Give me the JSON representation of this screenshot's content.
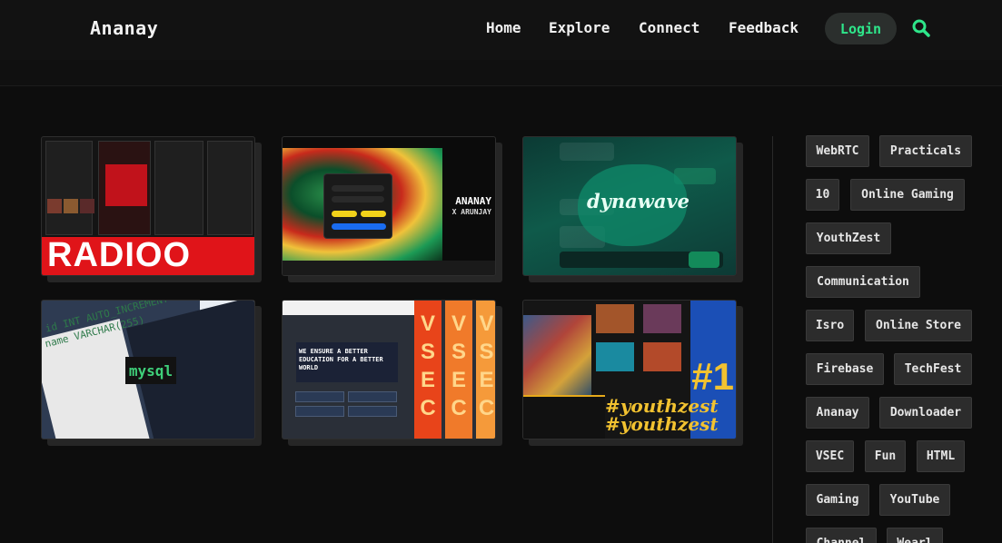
{
  "brand": "Ananay",
  "nav": {
    "links": [
      "Home",
      "Explore",
      "Connect",
      "Feedback"
    ],
    "login": "Login"
  },
  "cards": [
    {
      "title": "RADIOO"
    },
    {
      "title": "ANANAY",
      "subtitle": "X ARUNJAY"
    },
    {
      "title": "dynawave"
    },
    {
      "title": "mysql"
    },
    {
      "title": "VSEC",
      "banner": "WE ENSURE A BETTER EDUCATION FOR A BETTER WORLD"
    },
    {
      "title": "#youthzest",
      "badge": "#1"
    }
  ],
  "tags": [
    "WebRTC",
    "Practicals",
    "10",
    "Online Gaming",
    "YouthZest",
    "Communication",
    "Isro",
    "Online Store",
    "Firebase",
    "TechFest",
    "Ananay",
    "Downloader",
    "VSEC",
    "Fun",
    "HTML",
    "Gaming",
    "YouTube",
    "Channel",
    "Wearl"
  ],
  "colors": {
    "accent": "#2ee68a",
    "background": "#0d0d0d",
    "tag_bg": "#2c2c2c"
  }
}
